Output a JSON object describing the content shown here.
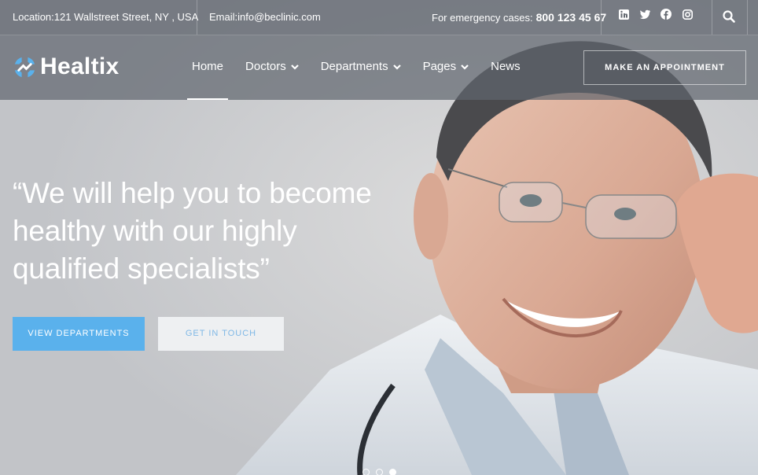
{
  "topbar": {
    "location": "Location:121 Wallstreet Street, NY , USA",
    "email": "Email:info@beclinic.com",
    "emergency_label": "For emergency cases:",
    "emergency_phone": "800 123 45 67",
    "social_icons": [
      "linkedin-icon",
      "twitter-icon",
      "facebook-icon",
      "instagram-icon"
    ],
    "search_icon": "search-icon"
  },
  "brand": {
    "name": "Healtix",
    "accent": "#5ab1ec"
  },
  "nav": {
    "items": [
      {
        "label": "Home",
        "active": true,
        "dropdown": false
      },
      {
        "label": "Doctors",
        "active": false,
        "dropdown": true
      },
      {
        "label": "Departments",
        "active": false,
        "dropdown": true
      },
      {
        "label": "Pages",
        "active": false,
        "dropdown": true
      },
      {
        "label": "News",
        "active": false,
        "dropdown": false
      }
    ],
    "cta": "MAKE AN APPOINTMENT"
  },
  "hero": {
    "headline_line1": "“We will help you to become",
    "headline_line2": "healthy with our highly",
    "headline_line3": "qualified specialists”",
    "primary_button": "VIEW DEPARTMENTS",
    "secondary_button": "GET IN TOUCH",
    "slides": 3,
    "active_slide": 3
  }
}
